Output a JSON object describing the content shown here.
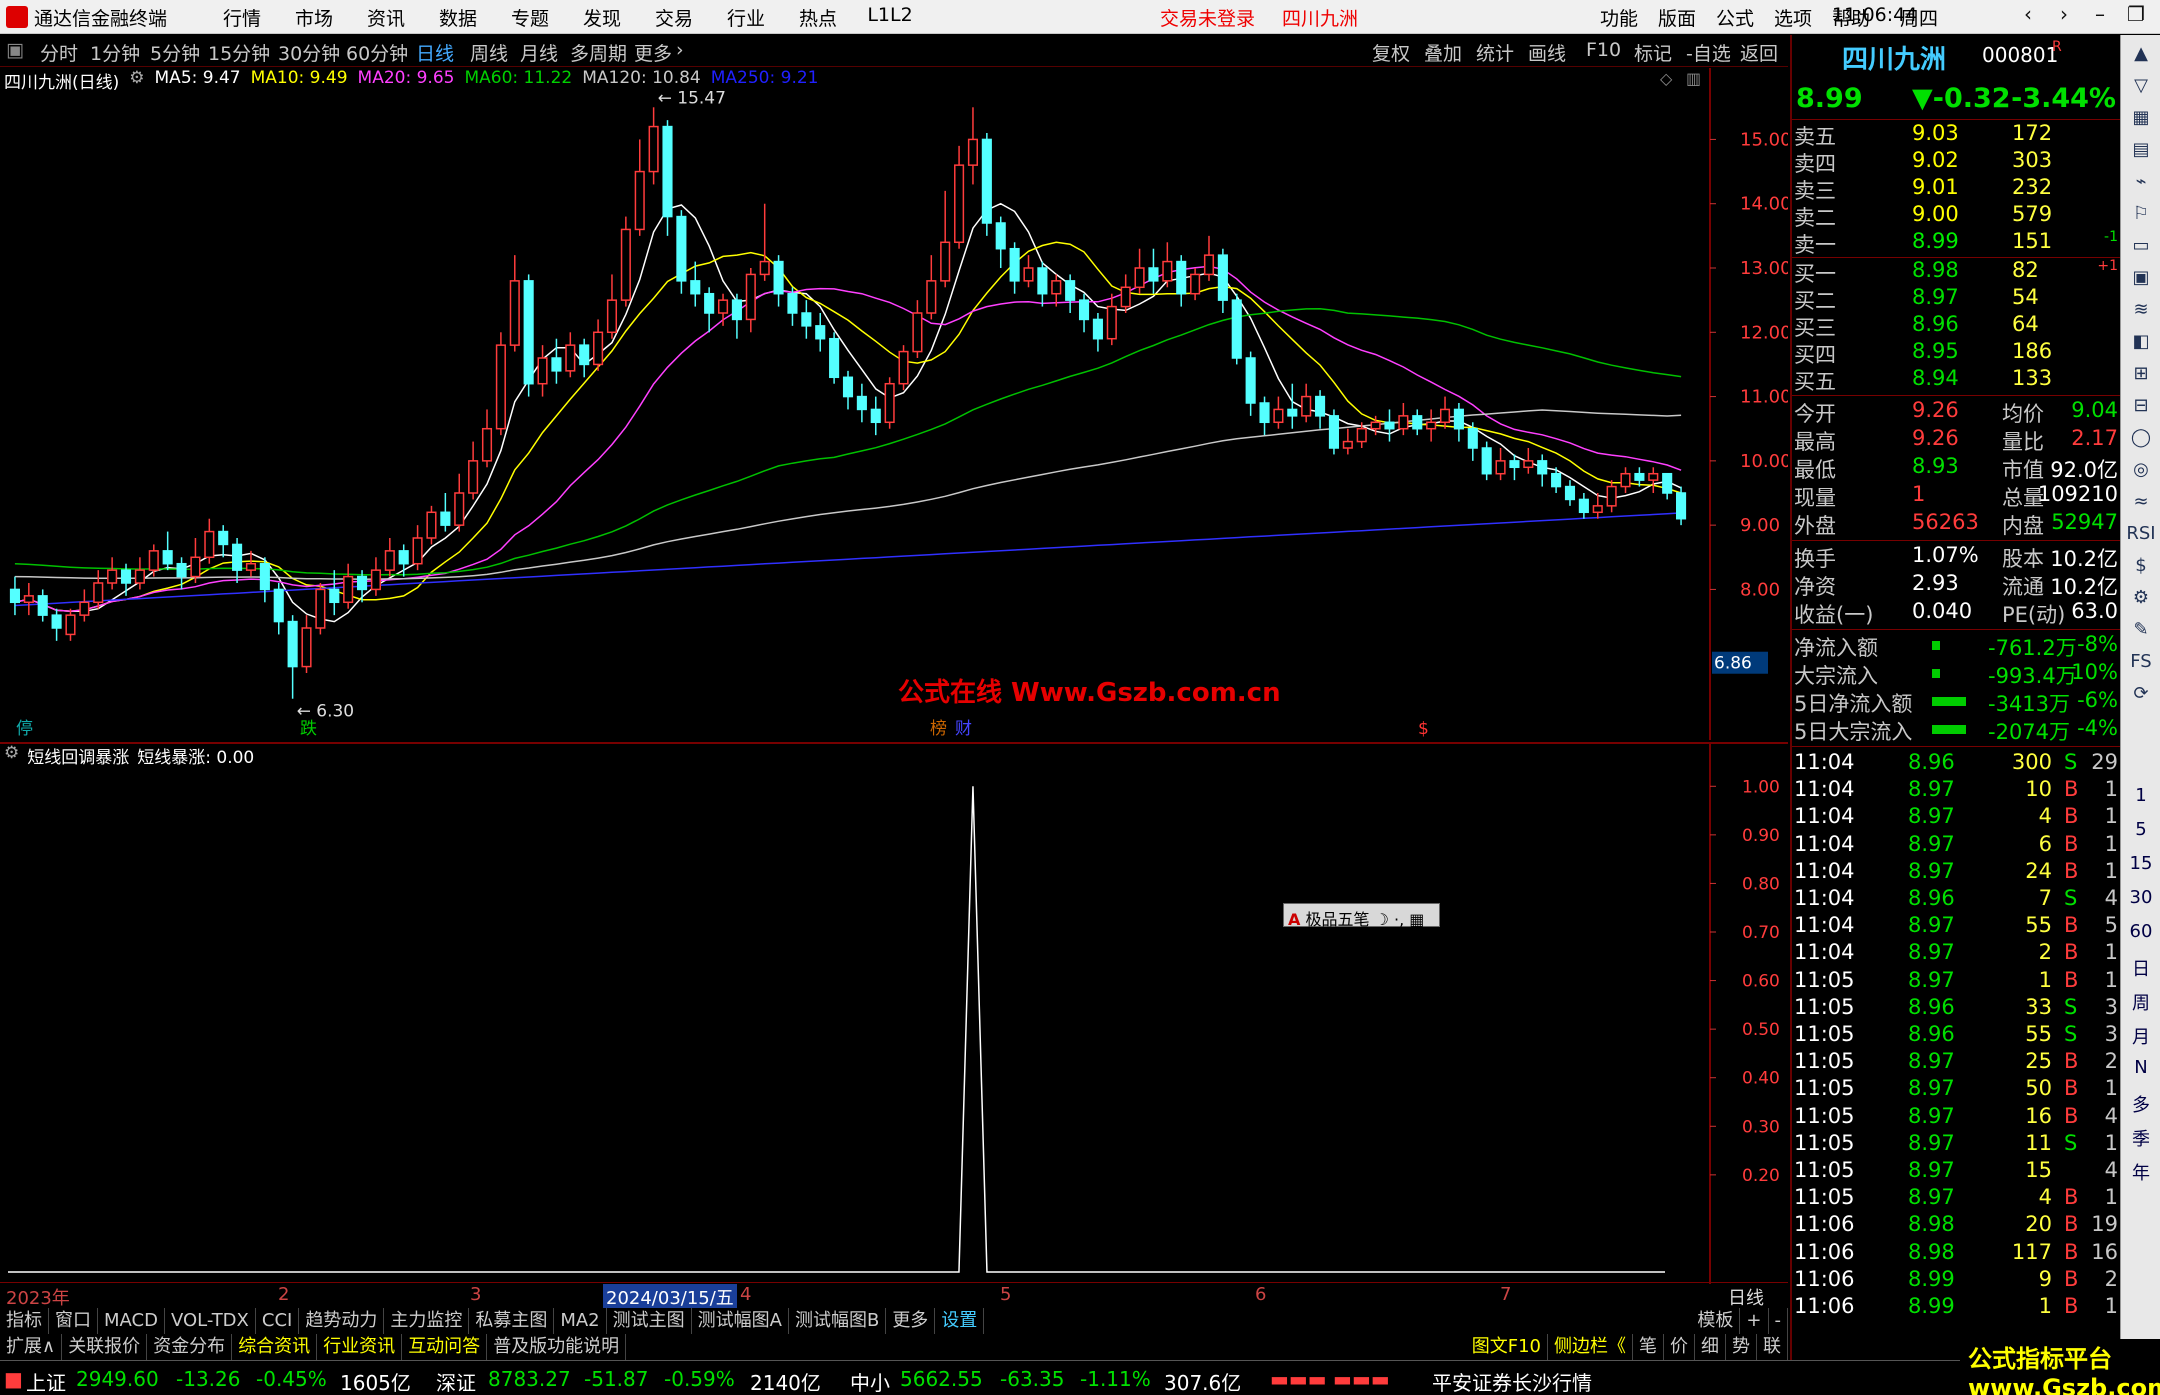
{
  "titlebar": {
    "app_title": "通达信金融终端",
    "menu_left": [
      "行情",
      "市场",
      "资讯",
      "数据",
      "专题",
      "发现",
      "交易",
      "行业",
      "热点",
      "L1L2"
    ],
    "notice": "交易未登录",
    "stock_name": "四川九洲",
    "menu_right": [
      "功能",
      "版面",
      "公式",
      "选项",
      "帮助"
    ],
    "clock": "11:06:44",
    "weekday": "周四"
  },
  "periodbar": {
    "items": [
      "分时",
      "1分钟",
      "5分钟",
      "15分钟",
      "30分钟",
      "60分钟",
      "日线",
      "周线",
      "月线",
      "多周期",
      "更多"
    ],
    "active": "日线",
    "right": [
      "复权",
      "叠加",
      "统计",
      "画线",
      "F10",
      "标记",
      "-自选",
      "返回"
    ]
  },
  "main": {
    "title": "四川九洲(日线)",
    "ma": [
      {
        "label": "MA5: 9.47",
        "color": "#ffffff"
      },
      {
        "label": "MA10: 9.49",
        "color": "#ffff00"
      },
      {
        "label": "MA20: 9.65",
        "color": "#ff40ff"
      },
      {
        "label": "MA60: 11.22",
        "color": "#00d000"
      },
      {
        "label": "MA120: 10.84",
        "color": "#c8c8c8"
      },
      {
        "label": "MA250: 9.21",
        "color": "#2020ff"
      }
    ],
    "y_ticks": [
      "15.00",
      "14.00",
      "13.00",
      "12.00",
      "11.00",
      "10.00",
      "9.00",
      "8.00"
    ],
    "high_label": "15.47",
    "low_label": "6.30",
    "price_tag": "6.86",
    "markers": [
      "停",
      "跌",
      "榜",
      "财",
      "$"
    ]
  },
  "sub": {
    "title": "短线回调暴涨",
    "value_label": "短线暴涨: 0.00",
    "y_ticks": [
      "1.00",
      "0.90",
      "0.80",
      "0.70",
      "0.60",
      "0.50",
      "0.40",
      "0.30",
      "0.20"
    ]
  },
  "dates": {
    "labels": [
      "2023年",
      "2",
      "3",
      "2024/03/15/五",
      "4",
      "5",
      "6",
      "7"
    ],
    "right": "日线"
  },
  "tabs1": [
    "指标",
    "窗口",
    "MACD",
    "VOL-TDX",
    "CCI",
    "趋势动力",
    "主力监控",
    "私募主图",
    "MA2",
    "测试主图",
    "测试幅图A",
    "测试幅图B",
    "更多",
    "设置"
  ],
  "tabs1_right": [
    "模板",
    "+",
    "-"
  ],
  "tabs2": [
    "扩展∧",
    "关联报价",
    "资金分布",
    "综合资讯",
    "行业资讯",
    "互动问答",
    "普及版功能说明"
  ],
  "tabs2_right": [
    "图文F10",
    "侧边栏《",
    "笔",
    "价",
    "细",
    "势",
    "联"
  ],
  "popup": "极品五笔",
  "watermark": "公式在线 Www.Gszb.com.cn",
  "brand": "公式指标平台 www.Gszb.com",
  "panel": {
    "name": "四川九洲",
    "code": "000801",
    "flag": "R",
    "price": "8.99",
    "change": "▼-0.32",
    "pct": "-3.44%",
    "asks": [
      {
        "l": "卖五",
        "p": "9.03",
        "v": "172",
        "x": ""
      },
      {
        "l": "卖四",
        "p": "9.02",
        "v": "303",
        "x": ""
      },
      {
        "l": "卖三",
        "p": "9.01",
        "v": "232",
        "x": ""
      },
      {
        "l": "卖二",
        "p": "9.00",
        "v": "579",
        "x": ""
      },
      {
        "l": "卖一",
        "p": "8.99",
        "v": "151",
        "x": "-1"
      }
    ],
    "bids": [
      {
        "l": "买一",
        "p": "8.98",
        "v": "82",
        "x": "+1"
      },
      {
        "l": "买二",
        "p": "8.97",
        "v": "54",
        "x": ""
      },
      {
        "l": "买三",
        "p": "8.96",
        "v": "64",
        "x": ""
      },
      {
        "l": "买四",
        "p": "8.95",
        "v": "186",
        "x": ""
      },
      {
        "l": "买五",
        "p": "8.94",
        "v": "133",
        "x": ""
      }
    ],
    "stats": [
      {
        "a": "今开",
        "b": "9.26",
        "c": "均价",
        "d": "9.04"
      },
      {
        "a": "最高",
        "b": "9.26",
        "c": "量比",
        "d": "2.17"
      },
      {
        "a": "最低",
        "b": "8.93",
        "c": "市值",
        "d": "92.0亿"
      },
      {
        "a": "现量",
        "b": "1",
        "c": "总量",
        "d": "109210"
      },
      {
        "a": "外盘",
        "b": "56263",
        "c": "内盘",
        "d": "52947"
      }
    ],
    "stats2": [
      {
        "a": "换手",
        "b": "1.07%",
        "c": "股本",
        "d": "10.2亿"
      },
      {
        "a": "净资",
        "b": "2.93",
        "c": "流通",
        "d": "10.2亿"
      },
      {
        "a": "收益(一)",
        "b": "0.040",
        "c": "PE(动)",
        "d": "63.0"
      }
    ],
    "flows": [
      {
        "a": "净流入额",
        "b": "-761.2万",
        "c": "-8%"
      },
      {
        "a": "大宗流入",
        "b": "-993.4万",
        "c": "-10%"
      },
      {
        "a": "5日净流入额",
        "b": "-3413万",
        "c": "-6%"
      },
      {
        "a": "5日大宗流入",
        "b": "-2074万",
        "c": "-4%"
      }
    ],
    "ticks": [
      [
        "11:04",
        "8.96",
        "300",
        "S",
        "29"
      ],
      [
        "11:04",
        "8.97",
        "10",
        "B",
        "1"
      ],
      [
        "11:04",
        "8.97",
        "4",
        "B",
        "1"
      ],
      [
        "11:04",
        "8.97",
        "6",
        "B",
        "1"
      ],
      [
        "11:04",
        "8.97",
        "24",
        "B",
        "1"
      ],
      [
        "11:04",
        "8.96",
        "7",
        "S",
        "4"
      ],
      [
        "11:04",
        "8.97",
        "55",
        "B",
        "5"
      ],
      [
        "11:04",
        "8.97",
        "2",
        "B",
        "1"
      ],
      [
        "11:05",
        "8.97",
        "1",
        "B",
        "1"
      ],
      [
        "11:05",
        "8.96",
        "33",
        "S",
        "3"
      ],
      [
        "11:05",
        "8.96",
        "55",
        "S",
        "3"
      ],
      [
        "11:05",
        "8.97",
        "25",
        "B",
        "2"
      ],
      [
        "11:05",
        "8.97",
        "50",
        "B",
        "1"
      ],
      [
        "11:05",
        "8.97",
        "16",
        "B",
        "4"
      ],
      [
        "11:05",
        "8.97",
        "11",
        "S",
        "1"
      ],
      [
        "11:05",
        "8.97",
        "15",
        "",
        "4"
      ],
      [
        "11:05",
        "8.97",
        "4",
        "B",
        "1"
      ],
      [
        "11:06",
        "8.98",
        "20",
        "B",
        "19"
      ],
      [
        "11:06",
        "8.98",
        "117",
        "B",
        "16"
      ],
      [
        "11:06",
        "8.99",
        "9",
        "B",
        "2"
      ],
      [
        "11:06",
        "8.99",
        "1",
        "B",
        "1"
      ]
    ]
  },
  "status": {
    "sh_name": "上证",
    "sh_val": "2949.60",
    "sh_chg": "-13.26",
    "sh_pct": "-0.45%",
    "sh_amt": "1605亿",
    "sz_name": "深证",
    "sz_val": "8783.27",
    "sz_chg": "-51.87",
    "sz_pct": "-0.59%",
    "sz_amt": "2140亿",
    "zx_name": "中小",
    "zx_val": "5662.55",
    "zx_chg": "-63.35",
    "zx_pct": "-1.11%",
    "zx_amt": "307.6亿",
    "broker": "平安证券长沙行情"
  },
  "sideicons": [
    "1",
    "5",
    "15",
    "30",
    "60",
    "日",
    "周",
    "月",
    "N",
    "多",
    "季",
    "年"
  ],
  "chart_data": {
    "type": "candlestick",
    "title": "四川九洲(日线)",
    "ylim": [
      6.0,
      15.8
    ],
    "candles": [
      [
        8.0,
        7.8,
        8.2,
        7.6
      ],
      [
        7.8,
        7.9,
        8.1,
        7.6
      ],
      [
        7.9,
        7.6,
        8.0,
        7.5
      ],
      [
        7.6,
        7.4,
        7.7,
        7.2
      ],
      [
        7.3,
        7.6,
        7.7,
        7.2
      ],
      [
        7.6,
        7.8,
        8.0,
        7.5
      ],
      [
        7.8,
        8.1,
        8.3,
        7.7
      ],
      [
        8.1,
        8.3,
        8.5,
        8.0
      ],
      [
        8.3,
        8.1,
        8.4,
        7.9
      ],
      [
        8.1,
        8.3,
        8.5,
        8.0
      ],
      [
        8.3,
        8.6,
        8.7,
        8.2
      ],
      [
        8.6,
        8.4,
        8.9,
        8.3
      ],
      [
        8.4,
        8.2,
        8.5,
        8.0
      ],
      [
        8.2,
        8.5,
        8.8,
        8.1
      ],
      [
        8.5,
        8.9,
        9.1,
        8.4
      ],
      [
        8.9,
        8.7,
        9.0,
        8.5
      ],
      [
        8.7,
        8.3,
        8.8,
        8.1
      ],
      [
        8.3,
        8.4,
        8.6,
        8.2
      ],
      [
        8.4,
        8.0,
        8.5,
        7.8
      ],
      [
        8.0,
        7.5,
        8.1,
        7.3
      ],
      [
        7.5,
        6.8,
        7.6,
        6.3
      ],
      [
        6.8,
        7.4,
        7.6,
        6.7
      ],
      [
        7.4,
        8.0,
        8.1,
        7.3
      ],
      [
        8.0,
        7.8,
        8.3,
        7.6
      ],
      [
        7.8,
        8.2,
        8.4,
        7.7
      ],
      [
        8.2,
        8.0,
        8.3,
        7.8
      ],
      [
        8.0,
        8.3,
        8.5,
        7.9
      ],
      [
        8.3,
        8.6,
        8.8,
        8.2
      ],
      [
        8.6,
        8.4,
        8.7,
        8.2
      ],
      [
        8.4,
        8.8,
        9.0,
        8.3
      ],
      [
        8.8,
        9.2,
        9.3,
        8.7
      ],
      [
        9.2,
        9.0,
        9.5,
        8.9
      ],
      [
        9.0,
        9.5,
        9.8,
        8.9
      ],
      [
        9.5,
        10.0,
        10.3,
        9.4
      ],
      [
        10.0,
        10.5,
        10.8,
        9.9
      ],
      [
        10.5,
        11.8,
        12.0,
        10.4
      ],
      [
        11.8,
        12.8,
        13.2,
        11.7
      ],
      [
        12.8,
        11.2,
        12.9,
        11.0
      ],
      [
        11.2,
        11.6,
        11.8,
        11.0
      ],
      [
        11.6,
        11.4,
        11.9,
        11.2
      ],
      [
        11.4,
        11.8,
        12.0,
        11.3
      ],
      [
        11.8,
        11.5,
        11.9,
        11.3
      ],
      [
        11.5,
        12.0,
        12.2,
        11.4
      ],
      [
        12.0,
        12.5,
        12.9,
        11.9
      ],
      [
        12.5,
        13.6,
        13.8,
        12.4
      ],
      [
        13.6,
        14.5,
        15.0,
        13.5
      ],
      [
        14.5,
        15.2,
        15.5,
        14.3
      ],
      [
        15.2,
        13.8,
        15.3,
        13.5
      ],
      [
        13.8,
        12.8,
        13.9,
        12.6
      ],
      [
        12.8,
        12.6,
        13.1,
        12.4
      ],
      [
        12.6,
        12.3,
        12.7,
        12.0
      ],
      [
        12.3,
        12.5,
        12.6,
        12.1
      ],
      [
        12.5,
        12.2,
        12.6,
        11.9
      ],
      [
        12.2,
        12.9,
        13.0,
        12.0
      ],
      [
        12.9,
        13.1,
        14.0,
        12.8
      ],
      [
        13.1,
        12.6,
        13.2,
        12.4
      ],
      [
        12.6,
        12.3,
        12.7,
        12.1
      ],
      [
        12.3,
        12.1,
        12.5,
        11.9
      ],
      [
        12.1,
        11.9,
        12.3,
        11.7
      ],
      [
        11.9,
        11.3,
        12.0,
        11.2
      ],
      [
        11.3,
        11.0,
        11.4,
        10.8
      ],
      [
        11.0,
        10.8,
        11.2,
        10.6
      ],
      [
        10.8,
        10.6,
        11.0,
        10.4
      ],
      [
        10.6,
        11.2,
        11.3,
        10.5
      ],
      [
        11.2,
        11.7,
        11.8,
        11.1
      ],
      [
        11.7,
        12.3,
        12.5,
        11.6
      ],
      [
        12.3,
        12.8,
        13.2,
        12.2
      ],
      [
        12.8,
        13.4,
        14.2,
        12.7
      ],
      [
        13.4,
        14.6,
        14.9,
        13.3
      ],
      [
        14.6,
        15.0,
        15.5,
        14.3
      ],
      [
        15.0,
        13.7,
        15.1,
        13.5
      ],
      [
        13.7,
        13.3,
        13.8,
        13.0
      ],
      [
        13.3,
        12.8,
        13.4,
        12.6
      ],
      [
        12.8,
        13.0,
        13.2,
        12.7
      ],
      [
        13.0,
        12.6,
        13.1,
        12.4
      ],
      [
        12.6,
        12.8,
        12.9,
        12.4
      ],
      [
        12.8,
        12.5,
        12.9,
        12.3
      ],
      [
        12.5,
        12.2,
        12.6,
        12.0
      ],
      [
        12.2,
        11.9,
        12.3,
        11.7
      ],
      [
        11.9,
        12.4,
        12.6,
        11.8
      ],
      [
        12.4,
        12.7,
        12.9,
        12.3
      ],
      [
        12.7,
        13.0,
        13.3,
        12.6
      ],
      [
        13.0,
        12.8,
        13.3,
        12.6
      ],
      [
        12.8,
        13.1,
        13.4,
        12.7
      ],
      [
        13.1,
        12.6,
        13.2,
        12.4
      ],
      [
        12.6,
        12.9,
        13.0,
        12.5
      ],
      [
        12.9,
        13.2,
        13.5,
        12.8
      ],
      [
        13.2,
        12.5,
        13.3,
        12.3
      ],
      [
        12.5,
        11.6,
        12.6,
        11.5
      ],
      [
        11.6,
        10.9,
        11.7,
        10.7
      ],
      [
        10.9,
        10.6,
        11.0,
        10.4
      ],
      [
        10.6,
        10.8,
        11.0,
        10.5
      ],
      [
        10.8,
        10.7,
        11.2,
        10.5
      ],
      [
        10.7,
        11.0,
        11.2,
        10.6
      ],
      [
        11.0,
        10.7,
        11.1,
        10.5
      ],
      [
        10.7,
        10.2,
        10.8,
        10.1
      ],
      [
        10.2,
        10.3,
        10.5,
        10.1
      ],
      [
        10.3,
        10.5,
        10.6,
        10.2
      ],
      [
        10.5,
        10.6,
        10.7,
        10.4
      ],
      [
        10.6,
        10.5,
        10.8,
        10.3
      ],
      [
        10.5,
        10.7,
        10.9,
        10.4
      ],
      [
        10.7,
        10.5,
        10.8,
        10.4
      ],
      [
        10.5,
        10.6,
        10.8,
        10.3
      ],
      [
        10.6,
        10.8,
        11.0,
        10.5
      ],
      [
        10.8,
        10.5,
        10.9,
        10.3
      ],
      [
        10.5,
        10.2,
        10.6,
        10.0
      ],
      [
        10.2,
        9.8,
        10.3,
        9.7
      ],
      [
        9.8,
        10.0,
        10.2,
        9.7
      ],
      [
        10.0,
        9.9,
        10.1,
        9.7
      ],
      [
        9.9,
        10.0,
        10.2,
        9.8
      ],
      [
        10.0,
        9.8,
        10.1,
        9.6
      ],
      [
        9.8,
        9.6,
        9.9,
        9.5
      ],
      [
        9.6,
        9.4,
        9.7,
        9.3
      ],
      [
        9.4,
        9.2,
        9.5,
        9.1
      ],
      [
        9.2,
        9.3,
        9.5,
        9.1
      ],
      [
        9.3,
        9.6,
        9.7,
        9.2
      ],
      [
        9.6,
        9.8,
        9.9,
        9.5
      ],
      [
        9.8,
        9.7,
        9.9,
        9.6
      ],
      [
        9.7,
        9.8,
        9.9,
        9.5
      ],
      [
        9.8,
        9.5,
        9.8,
        9.4
      ],
      [
        9.5,
        9.1,
        9.6,
        9.0
      ]
    ],
    "ma_periods": [
      5,
      10,
      20,
      60,
      120,
      250
    ],
    "sub_series": {
      "name": "短线暴涨",
      "spike_index": 69,
      "value": 1.0,
      "ylim": [
        0,
        1.05
      ]
    }
  }
}
